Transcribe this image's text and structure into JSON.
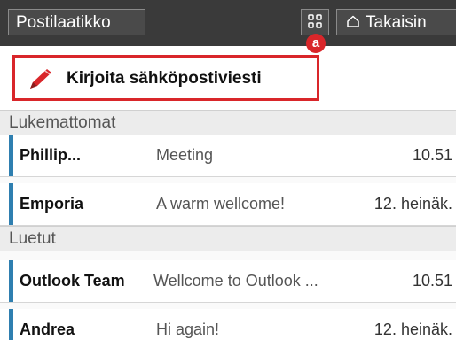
{
  "topbar": {
    "title": "Postilaatikko",
    "back_label": "Takaisin"
  },
  "compose": {
    "label": "Kirjoita sähköpostiviesti",
    "badge": "a"
  },
  "sections": [
    {
      "title": "Lukemattomat",
      "rows": [
        {
          "sender": "Phillip...",
          "subject": "Meeting",
          "date": "10.51"
        },
        {
          "sender": "Emporia",
          "subject": "A warm wellcome!",
          "date": "12. heinäk."
        }
      ]
    },
    {
      "title": "Luetut",
      "rows": [
        {
          "sender": "Outlook Team",
          "subject": "Wellcome to Outlook ...",
          "date": "10.51"
        },
        {
          "sender": "Andrea",
          "subject": "Hi again!",
          "date": "12. heinäk."
        }
      ]
    }
  ],
  "colors": {
    "accent": "#2f7fb0",
    "highlight": "#d9262a",
    "topbar": "#3a3a3a"
  },
  "icons": {
    "grid": "apps-grid-icon",
    "home": "home-icon",
    "compose": "pencil-icon"
  }
}
